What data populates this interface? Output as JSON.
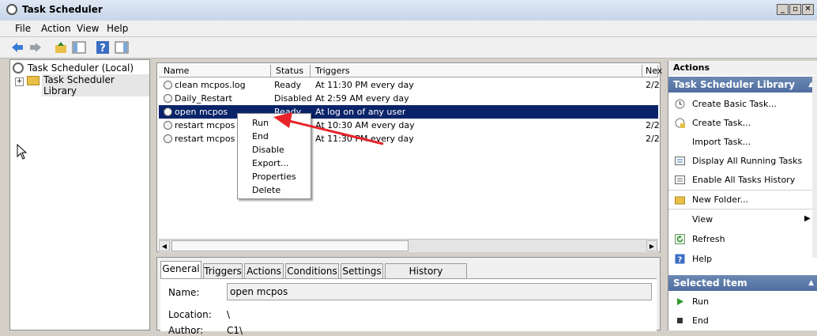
{
  "window": {
    "title": "Task Scheduler"
  },
  "menu": [
    "File",
    "Action",
    "View",
    "Help"
  ],
  "tree": {
    "root": "Task Scheduler (Local)",
    "child": "Task Scheduler Library"
  },
  "list": {
    "columns": [
      "Name",
      "Status",
      "Triggers",
      "Nex"
    ],
    "rows": [
      {
        "name": "clean mcpos.log",
        "status": "Ready",
        "trigger": "At 11:30 PM every day",
        "next": "2/2"
      },
      {
        "name": "Daily_Restart",
        "status": "Disabled",
        "trigger": "At 2:59 AM every day",
        "next": ""
      },
      {
        "name": "open mcpos",
        "status": "Ready",
        "trigger": "At log on of any user",
        "next": ""
      },
      {
        "name": "restart mcpos m",
        "status": "",
        "trigger": "At 10:30 AM every day",
        "next": "2/2"
      },
      {
        "name": "restart mcpos ni",
        "status": "",
        "trigger": "At 11:30 PM every day",
        "next": "2/2"
      }
    ],
    "selected_index": 2
  },
  "context_menu": [
    "Run",
    "End",
    "Disable",
    "Export...",
    "Properties",
    "Delete"
  ],
  "detail": {
    "tabs": [
      "General",
      "Triggers",
      "Actions",
      "Conditions",
      "Settings",
      "History (disabled)"
    ],
    "name_label": "Name:",
    "name_value": "open mcpos",
    "location_label": "Location:",
    "location_value": "\\",
    "author_label": "Author:",
    "author_value": "C1\\"
  },
  "actions": {
    "header": "Actions",
    "section1": "Task Scheduler Library",
    "items1": [
      "Create Basic Task...",
      "Create Task...",
      "Import Task...",
      "Display All Running Tasks",
      "Enable All Tasks History",
      "New Folder...",
      "View",
      "Refresh",
      "Help"
    ],
    "section2": "Selected Item",
    "items2": [
      "Run",
      "End"
    ]
  },
  "colors": {
    "selection": "#0a246a",
    "section_header": "#5b79aa",
    "arrow": "#e8242a"
  }
}
